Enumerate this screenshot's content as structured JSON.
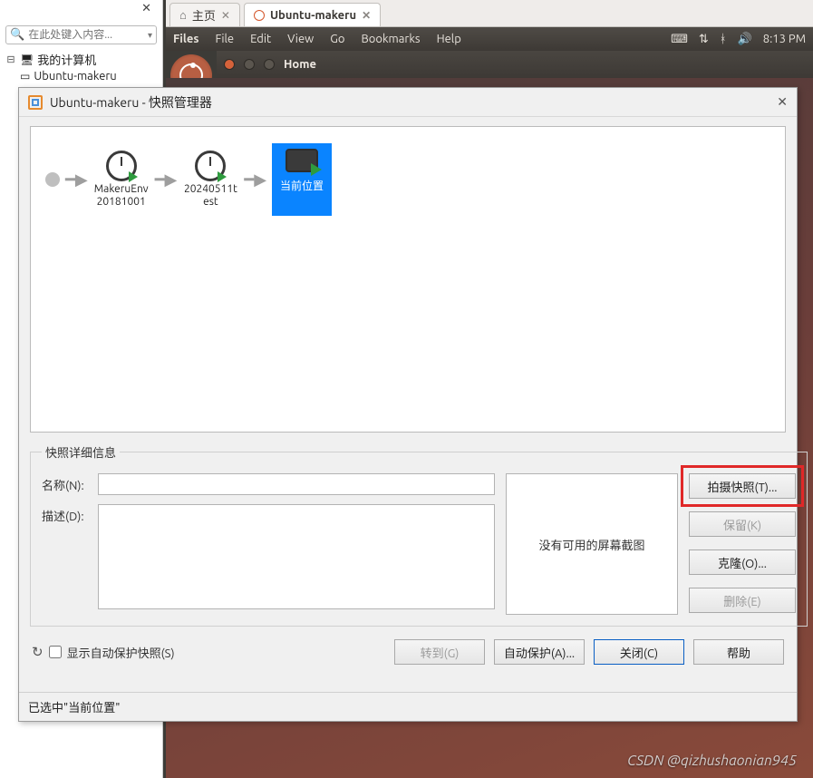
{
  "sidebar": {
    "search_placeholder": "在此处键入内容...",
    "root_label": "我的计算机",
    "vm_label": "Ubuntu-makeru"
  },
  "tabs": {
    "home": "主页",
    "vm": "Ubuntu-makeru"
  },
  "ubuntu_bar": {
    "app": "Files",
    "menus": [
      "File",
      "Edit",
      "View",
      "Go",
      "Bookmarks",
      "Help"
    ],
    "time": "8:13 PM",
    "nautilus_title": "Home"
  },
  "dialog": {
    "title": "Ubuntu-makeru - 快照管理器",
    "snapshots": [
      {
        "name": "MakeruEnv20181001"
      },
      {
        "name": "20240511test"
      }
    ],
    "current_label": "当前位置",
    "details_legend": "快照详细信息",
    "name_label": "名称(N):",
    "desc_label": "描述(D):",
    "name_value": "",
    "desc_value": "",
    "preview_text": "没有可用的屏幕截图",
    "side_buttons": {
      "take": "拍摄快照(T)...",
      "keep": "保留(K)",
      "clone": "克隆(O)...",
      "delete": "删除(E)"
    },
    "bottom": {
      "show_autoprotect": "显示自动保护快照(S)",
      "goto": "转到(G)",
      "autoprotect": "自动保护(A)...",
      "close": "关闭(C)",
      "help": "帮助"
    },
    "status": "已选中\"当前位置\""
  },
  "watermark": "CSDN @qizhushaonian945"
}
